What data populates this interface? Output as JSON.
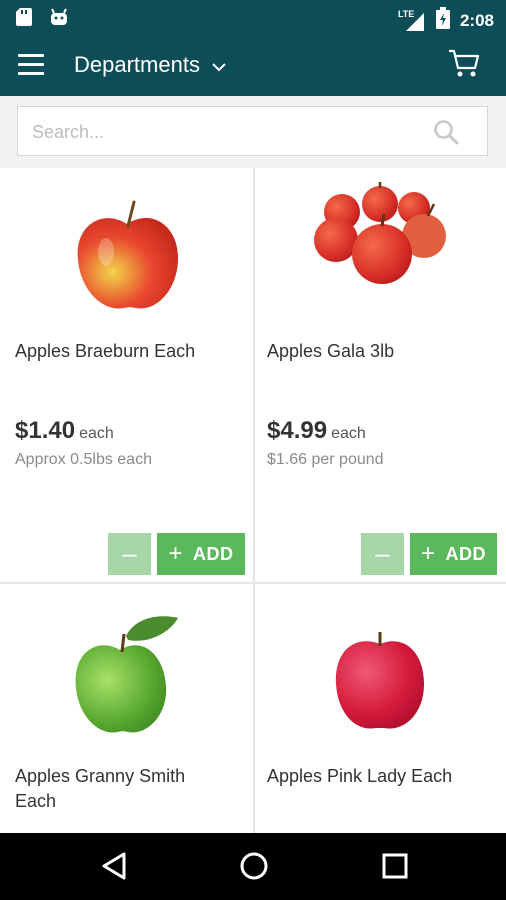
{
  "status": {
    "network": "LTE",
    "time": "2:08"
  },
  "appbar": {
    "title": "Departments"
  },
  "search": {
    "placeholder": "Search..."
  },
  "products": [
    {
      "name": "Apples Braeburn Each",
      "price": "$1.40",
      "unit": "each",
      "detail": "Approx 0.5lbs each",
      "add_label": "ADD",
      "minus_label": "–"
    },
    {
      "name": "Apples Gala 3lb",
      "price": "$4.99",
      "unit": "each",
      "detail": "$1.66 per pound",
      "add_label": "ADD",
      "minus_label": "–"
    },
    {
      "name": "Apples Granny Smith Each"
    },
    {
      "name": "Apples Pink Lady Each"
    }
  ],
  "colors": {
    "primary": "#0d4d57",
    "add": "#5cb85c",
    "minus": "#a7d6a7"
  }
}
